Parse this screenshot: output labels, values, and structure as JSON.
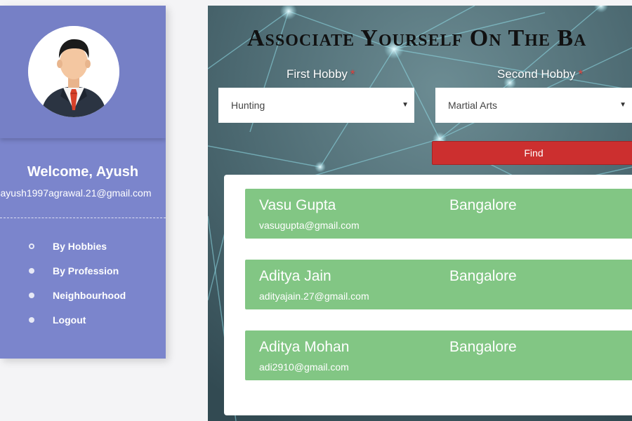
{
  "sidebar": {
    "welcome": "Welcome, Ayush",
    "email": "ayush1997agrawal.21@gmail.com",
    "nav": [
      {
        "label": "By Hobbies",
        "active": true
      },
      {
        "label": "By Profession",
        "active": false
      },
      {
        "label": "Neighbourhood",
        "active": false
      },
      {
        "label": "Logout",
        "active": false
      }
    ]
  },
  "main": {
    "title": "Associate Yourself On The Ba",
    "first_hobby": {
      "label": "First Hobby",
      "required_mark": "*",
      "selected": "Hunting"
    },
    "second_hobby": {
      "label": "Second Hobby",
      "required_mark": "*",
      "selected": "Martial Arts"
    },
    "find_label": "Find",
    "results": [
      {
        "name": "Vasu Gupta",
        "city": "Bangalore",
        "email": "vasugupta@gmail.com"
      },
      {
        "name": "Aditya Jain",
        "city": "Bangalore",
        "email": "adityajain.27@gmail.com"
      },
      {
        "name": "Aditya Mohan",
        "city": "Bangalore",
        "email": "adi2910@gmail.com"
      }
    ]
  },
  "colors": {
    "sidebar": "#7b85cc",
    "find_button": "#cc2f2f",
    "result_card": "#82c684",
    "required": "#e8413c"
  },
  "icons": {
    "avatar": "businessman-avatar-icon",
    "select_caret": "caret-down-icon",
    "nav_bullet": "bullet-icon"
  }
}
